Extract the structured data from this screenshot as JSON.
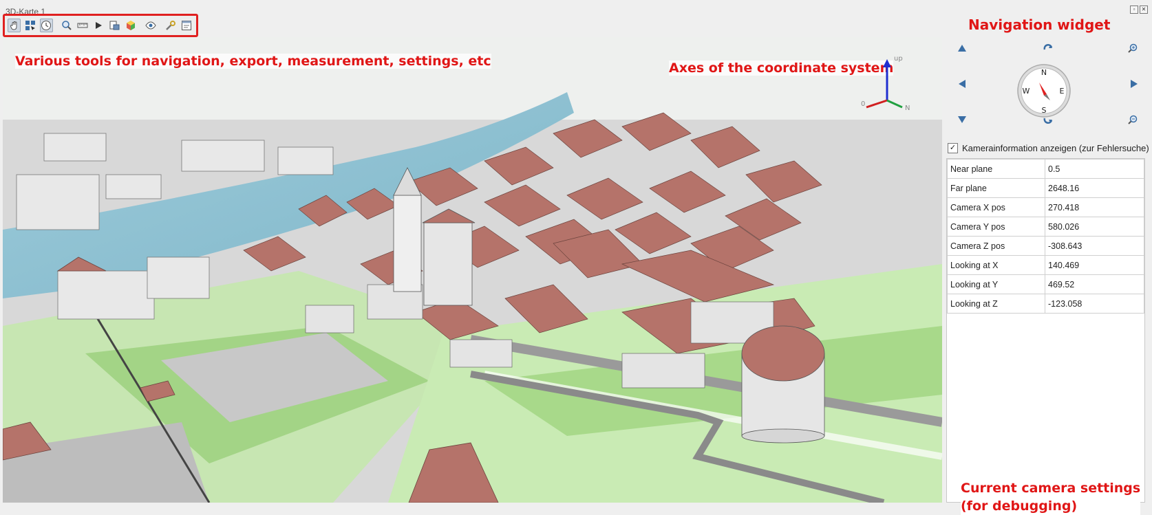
{
  "window": {
    "title": "3D-Karte 1",
    "float_icon": "float-window-icon",
    "close_icon": "close-icon"
  },
  "toolbar": {
    "tools": [
      {
        "name": "pan-hand-icon",
        "selected": true
      },
      {
        "name": "identify-icon",
        "selected": false
      },
      {
        "name": "animation-clock-icon",
        "selected": true
      },
      {
        "name": "zoom-full-icon",
        "selected": false
      },
      {
        "name": "measure-line-icon",
        "selected": false
      },
      {
        "name": "play-icon",
        "selected": false
      },
      {
        "name": "export-scene-icon",
        "selected": false
      },
      {
        "name": "3d-object-icon",
        "selected": false
      },
      {
        "name": "camera-view-icon",
        "selected": false
      },
      {
        "name": "settings-wrench-icon",
        "selected": false
      },
      {
        "name": "options-panel-icon",
        "selected": false
      }
    ]
  },
  "annotations": {
    "tools": "Various tools for navigation, export, measurement, settings, etc",
    "axes": "Axes of the coordinate system",
    "navigation": "Navigation widget",
    "camera_line1": "Current camera settings",
    "camera_line2": "(for debugging)"
  },
  "axes": {
    "up_label": "up",
    "north_label": "N",
    "origin_label": "0"
  },
  "navigation": {
    "compass": {
      "n": "N",
      "s": "S",
      "e": "E",
      "w": "W"
    }
  },
  "camera_info": {
    "checkbox_label": "Kamerainformation anzeigen (zur Fehlersuche)",
    "checked_mark": "✓",
    "rows": [
      {
        "key": "Near plane",
        "value": "0.5"
      },
      {
        "key": "Far plane",
        "value": "2648.16"
      },
      {
        "key": "Camera X pos",
        "value": "270.418"
      },
      {
        "key": "Camera Y pos",
        "value": "580.026"
      },
      {
        "key": "Camera Z pos",
        "value": "-308.643"
      },
      {
        "key": "Looking at X",
        "value": "140.469"
      },
      {
        "key": "Looking at Y",
        "value": "469.52"
      },
      {
        "key": "Looking at Z",
        "value": "-123.058"
      }
    ]
  },
  "colors": {
    "annotation": "#e01616",
    "roof": "#b5736a",
    "river": "#8fc2d4",
    "grass": "#a9d78f",
    "wall": "#e6e6e6"
  }
}
